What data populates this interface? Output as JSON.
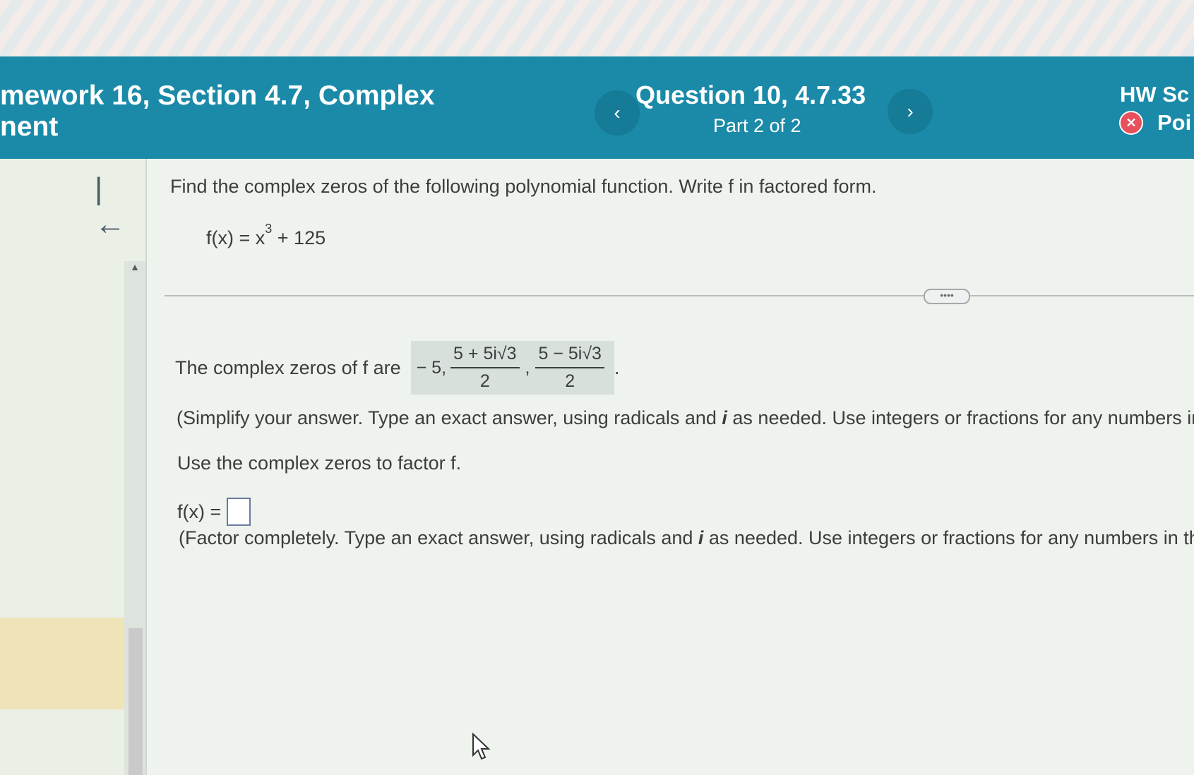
{
  "header": {
    "assignment_title": "mework 16, Section 4.7, Complex\nnent",
    "question_title": "Question 10, 4.7.33",
    "part": "Part 2 of 2",
    "prev_symbol": "‹",
    "next_symbol": "›",
    "hw_score_label": "HW Sc",
    "points_label": "Poi",
    "color": "#1a8aa8"
  },
  "question": {
    "instruction": "Find the complex zeros of the following polynomial function. Write f in factored form.",
    "function_lhs": "f(x) = x",
    "function_exp": "3",
    "function_rhs": " + 125"
  },
  "more_button": "••••",
  "answer": {
    "label": "The complex zeros of f are",
    "zero1": "− 5,",
    "zero2_num": "5 + 5i√3",
    "zero2_den": "2",
    "comma": ",",
    "zero3_num": "5 − 5i√3",
    "zero3_den": "2",
    "end": "."
  },
  "note1_a": "(Simplify your answer. Type an exact answer, using radicals and ",
  "note1_i": "i",
  "note1_b": " as needed. Use integers or fractions for any numbers in t",
  "factor_prompt": "Use the complex zeros to factor f.",
  "fx_label": "f(x) =",
  "fx_input_value": "",
  "note2_a": "(Factor completely. Type an exact answer, using radicals and ",
  "note2_i": "i",
  "note2_b": " as needed. Use integers or fractions for any numbers in the",
  "collapse_icon": "|←",
  "scroll_up_symbol": "▲"
}
